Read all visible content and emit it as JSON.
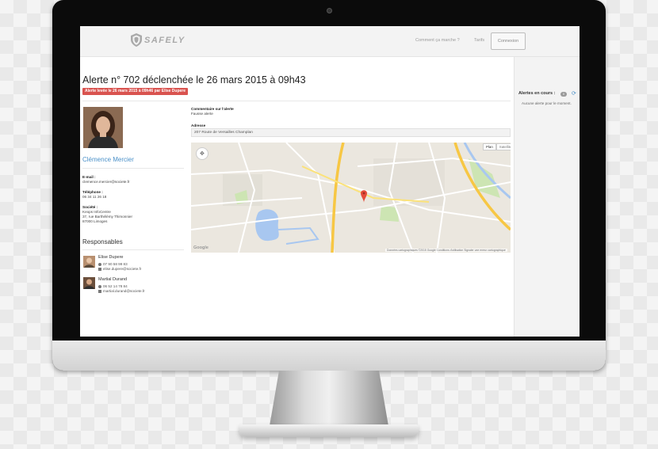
{
  "navbar": {
    "logo_text": "SAFELY",
    "links": [
      "Comment ça marche ?",
      "Tarifs"
    ],
    "login_button": "Connexion"
  },
  "alert": {
    "title": "Alerte n° 702 déclenchée le 26 mars 2015 à 09h43",
    "badge": "Alerte levée le 26 mars 2015 à 09h46 par Elise Dupere"
  },
  "person": {
    "name": "Clémence Mercier",
    "email_label": "E-mail :",
    "email": "clemence.mercier@societe.fr",
    "phone_label": "Téléphone :",
    "phone": "06 34 11 26 18",
    "company_label": "Société :",
    "company_lines": [
      "Keops InfoCentre",
      "37, rue Barthélémy Thimonnier",
      "87000 Limoges"
    ]
  },
  "responsables": {
    "title": "Responsables",
    "items": [
      {
        "name": "Elise Dupere",
        "phone": "07 90 58 99 83",
        "email": "elise.dupere@societe.fr"
      },
      {
        "name": "Martial Durand",
        "phone": "06 52 14 78 84",
        "email": "martial.durand@societe.fr"
      }
    ]
  },
  "details": {
    "comment_label": "Commentaire sur l'alerte",
    "comment": "Fausse alerte",
    "address_label": "Adresse",
    "address": "207 Route de Versailles Champlan"
  },
  "map": {
    "type_buttons": [
      "Plan",
      "Satellite"
    ],
    "footer": "Données cartographiques ©2015 Google   Conditions d'utilisation   Signaler une erreur cartographique",
    "google_mark": "Google",
    "colors": {
      "water": "#a8c7f0",
      "highway": "#f7c744",
      "park": "#cde5b3",
      "road": "#ffffff",
      "pin": "#e54b3b"
    }
  },
  "sidebar": {
    "title": "Alertes en cours :",
    "count": "0",
    "empty_text": "Aucune alerte pour le moment."
  }
}
